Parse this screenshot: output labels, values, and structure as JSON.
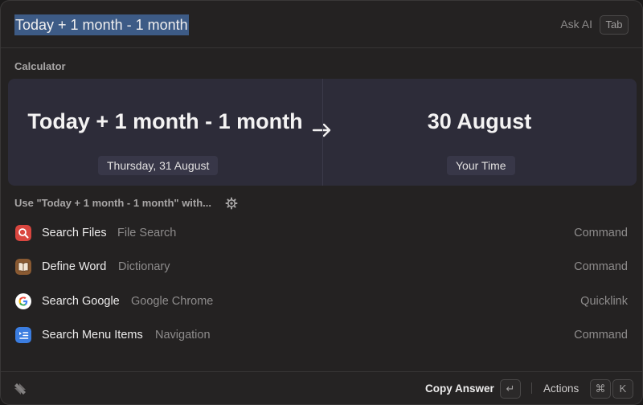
{
  "search": {
    "query": "Today + 1 month - 1 month",
    "ask_ai": "Ask AI",
    "tab_key": "Tab"
  },
  "calculator": {
    "section_label": "Calculator",
    "expression": "Today + 1 month - 1 month",
    "expression_detail": "Thursday, 31 August",
    "result": "30 August",
    "result_detail": "Your Time",
    "arrow_icon": "right-arrow-icon"
  },
  "use_with": {
    "label": "Use \"Today + 1 month - 1 month\" with...",
    "icon": "gear-icon"
  },
  "items": [
    {
      "title": "Search Files",
      "subtitle": "File Search",
      "kind": "Command",
      "icon": "file-search-icon",
      "color": "#d9463f"
    },
    {
      "title": "Define Word",
      "subtitle": "Dictionary",
      "kind": "Command",
      "icon": "dictionary-icon",
      "color": "#8a5a32"
    },
    {
      "title": "Search Google",
      "subtitle": "Google Chrome",
      "kind": "Quicklink",
      "icon": "google-icon",
      "color": "#ffffff"
    },
    {
      "title": "Search Menu Items",
      "subtitle": "Navigation",
      "kind": "Command",
      "icon": "menu-items-icon",
      "color": "#3b7de0"
    }
  ],
  "footer": {
    "logo": "raycast-logo-icon",
    "copy_answer": "Copy Answer",
    "enter_key": "↵",
    "actions": "Actions",
    "cmd_key": "⌘",
    "k_key": "K"
  }
}
